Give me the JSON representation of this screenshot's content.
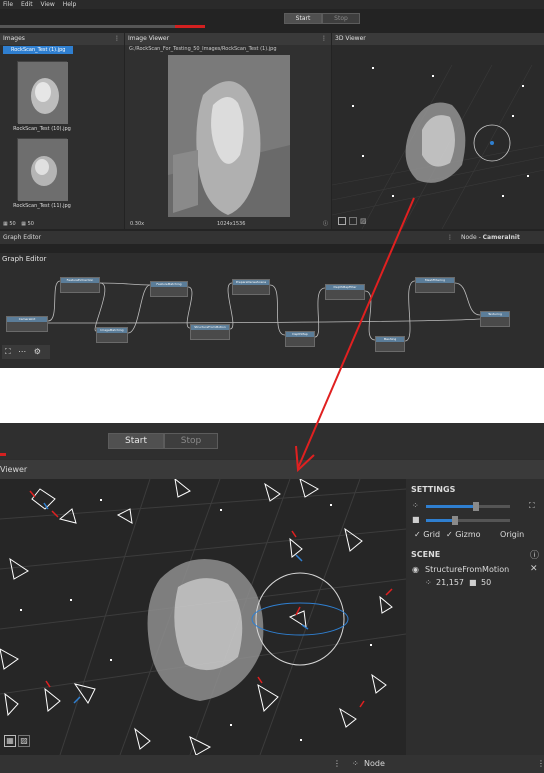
{
  "menu": {
    "items": [
      "File",
      "Edit",
      "View",
      "Help"
    ]
  },
  "toolbar_top": {
    "start": "Start",
    "stop": "Stop"
  },
  "images_panel": {
    "title": "Images",
    "selected_item": "RockScan_Test (1).jpg",
    "thumbs": [
      {
        "label": "RockScan_Test (10).jpg"
      },
      {
        "label": "RockScan_Test (11).jpg"
      }
    ],
    "footer": {
      "count_a": "50",
      "count_b": "50"
    }
  },
  "image_viewer": {
    "title": "Image Viewer",
    "path": "G:/RockScan_For_Testing_50_Images/RockScan_Test (1).jpg",
    "zoom": "0.30x",
    "resolution": "1024x1536"
  },
  "viewer3d_top": {
    "title": "3D Viewer"
  },
  "graph_editor_bar": {
    "left": "Graph Editor",
    "right_prefix": "Node - ",
    "right_node": "CameraInit"
  },
  "graph_editor": {
    "title": "Graph Editor",
    "nodes": [
      "CameraInit",
      "FeatureExtraction",
      "ImageMatching",
      "FeatureMatching",
      "StructureFromMotion",
      "PrepareDenseScene",
      "DepthMap",
      "DepthMapFilter",
      "Meshing",
      "MeshFiltering",
      "Texturing"
    ]
  },
  "toolbar_zoom": {
    "start": "Start",
    "stop": "Stop"
  },
  "viewer3d_zoom": {
    "title": "Viewer",
    "settings_title": "SETTINGS",
    "grid": "Grid",
    "gizmo": "Gizmo",
    "origin": "Origin",
    "scene_title": "SCENE",
    "scene_item": "StructureFromMotion",
    "points": "21,157",
    "cameras": "50",
    "node_label": "Node",
    "slider1": 0.6,
    "slider2": 0.35
  },
  "colors": {
    "accent": "#2f7fd0",
    "arrow": "#e02020",
    "progress": "#d32020"
  }
}
